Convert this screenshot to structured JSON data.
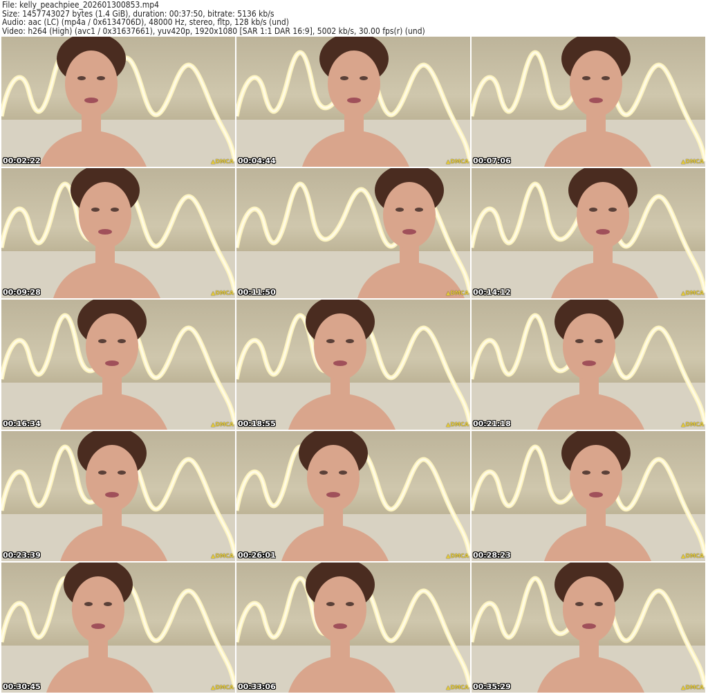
{
  "header": {
    "file": "File: kelly_peachpiee_202601300853.mp4",
    "size": "Size: 1457743027 bytes (1.4 GiB), duration: 00:37:50, bitrate: 5136 kb/s",
    "audio": "Audio: aac (LC) (mp4a / 0x6134706D), 48000 Hz, stereo, fltp, 128 kb/s (und)",
    "video": "Video: h264 (High) (avc1 / 0x31637661), yuv420p, 1920x1080 [SAR 1:1 DAR 16:9], 5002 kb/s, 30.00 fps(r) (und)"
  },
  "watermark": "▲DMCA",
  "colors": {
    "neon": "#fff6c0",
    "wall": "#c9c0a4",
    "skin": "#d9a58c",
    "hair": "#4a2c20"
  },
  "thumbnails": [
    {
      "timestamp": "00:02:22"
    },
    {
      "timestamp": "00:04:44"
    },
    {
      "timestamp": "00:07:06"
    },
    {
      "timestamp": "00:09:28"
    },
    {
      "timestamp": "00:11:50"
    },
    {
      "timestamp": "00:14:12"
    },
    {
      "timestamp": "00:16:34"
    },
    {
      "timestamp": "00:18:55"
    },
    {
      "timestamp": "00:21:18"
    },
    {
      "timestamp": "00:23:39"
    },
    {
      "timestamp": "00:26:01"
    },
    {
      "timestamp": "00:28:23"
    },
    {
      "timestamp": "00:30:45"
    },
    {
      "timestamp": "00:33:06"
    },
    {
      "timestamp": "00:35:29"
    }
  ]
}
